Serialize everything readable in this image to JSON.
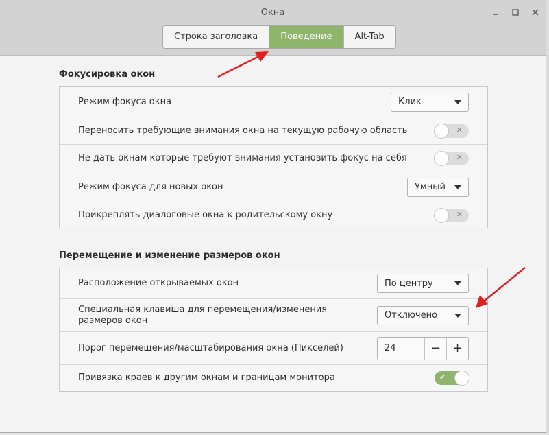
{
  "window": {
    "title": "Окна",
    "controls": {
      "minimize": "minimize-icon",
      "maximize": "maximize-icon",
      "close": "close-icon"
    }
  },
  "tabs": [
    {
      "label": "Строка заголовка",
      "active": false
    },
    {
      "label": "Поведение",
      "active": true
    },
    {
      "label": "Alt-Tab",
      "active": false
    }
  ],
  "focus_section": {
    "title": "Фокусировка окон",
    "rows": [
      {
        "label": "Режим фокуса окна",
        "control": "dropdown",
        "value": "Клик"
      },
      {
        "label": "Переносить требующие внимания окна на текущую рабочую область",
        "control": "switch",
        "state": "off"
      },
      {
        "label": "Не дать окнам которые требуют внимания установить фокус на себя",
        "control": "switch",
        "state": "off"
      },
      {
        "label": "Режим фокуса для новых окон",
        "control": "dropdown",
        "value": "Умный"
      },
      {
        "label": "Прикреплять диалоговые окна к родительскому окну",
        "control": "switch",
        "state": "off"
      }
    ]
  },
  "move_section": {
    "title": "Перемещение и изменение размеров окон",
    "rows": [
      {
        "label": "Расположение открываемых окон",
        "control": "dropdown",
        "value": "По центру"
      },
      {
        "label": "Специальная клавиша для перемещения/изменения размеров окон",
        "control": "dropdown",
        "value": "Отключено"
      },
      {
        "label": "Порог перемещения/масштабирования окна (Пикселей)",
        "control": "spin",
        "value": "24",
        "minus": "−",
        "plus": "+"
      },
      {
        "label": "Привязка краев к другим окнам и границам монитора",
        "control": "switch",
        "state": "on"
      }
    ]
  },
  "switch_marks": {
    "off": "✕",
    "on": "✔"
  },
  "colors": {
    "accent": "#8fb46b",
    "annotation_arrow": "#e02020"
  }
}
